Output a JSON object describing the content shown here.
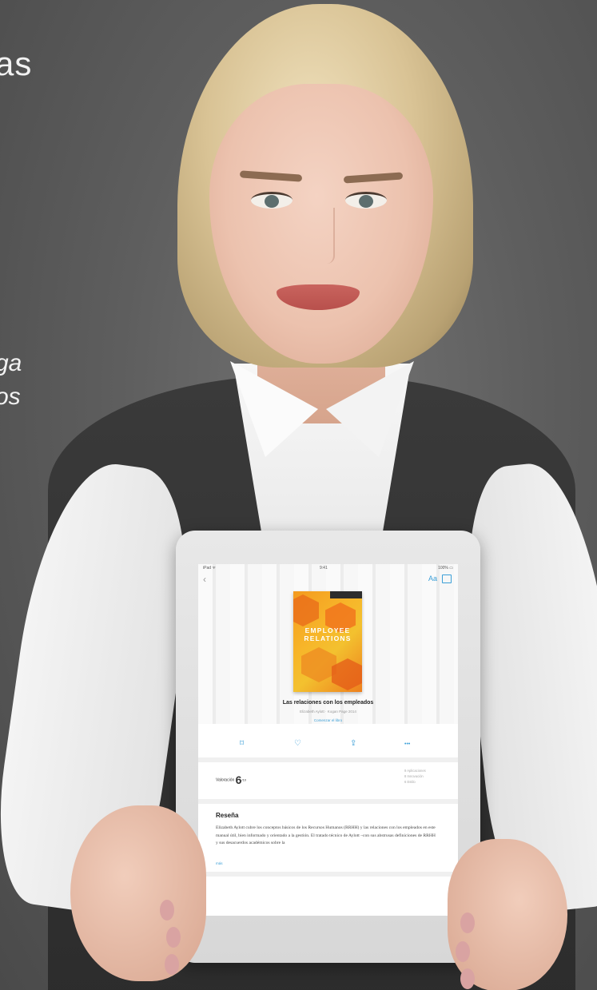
{
  "background": {
    "color": "#5b5b5b"
  },
  "overlay_text": {
    "headline_fragment": "as",
    "italic_line_1": "ga",
    "italic_line_2": "os"
  },
  "tablet": {
    "status_bar": {
      "left": "iPad ᯤ",
      "center": "9:41",
      "right": "100% ▭"
    },
    "nav": {
      "back_icon": "chevron-left-icon",
      "font_label": "Aa",
      "toc_icon": "list-icon"
    },
    "book": {
      "cover_title": "EMPLOYEE RELATIONS",
      "title": "Las relaciones con los empleados",
      "subtitle": "Elizabeth Aylott · Kogan Page 2014",
      "link": "Comenzar el libro"
    },
    "actions": [
      {
        "icon": "bookmark-icon",
        "glyph": "⌑"
      },
      {
        "icon": "heart-icon",
        "glyph": "♡"
      },
      {
        "icon": "share-icon",
        "glyph": "⇪"
      },
      {
        "icon": "more-icon",
        "glyph": "•••"
      }
    ],
    "reading": {
      "label": "Valoración",
      "value": "6",
      "unit": "/10"
    },
    "details": [
      "9 Aplicaciones",
      "8 Innovación",
      "6 Estilo"
    ],
    "review": {
      "heading": "Reseña",
      "body": "Elizabeth Aylott cubre los conceptos básicos de los Recursos Humanos (RRHH) y las relaciones con los empleados en este manual útil, bien informado y orientado a la gestión. El tratado técnico de Aylott –con sus abstrusas definiciones de RRHH y sus desacuerdos académicos sobre la",
      "more": "más"
    },
    "accent": "#3b9fd7"
  }
}
